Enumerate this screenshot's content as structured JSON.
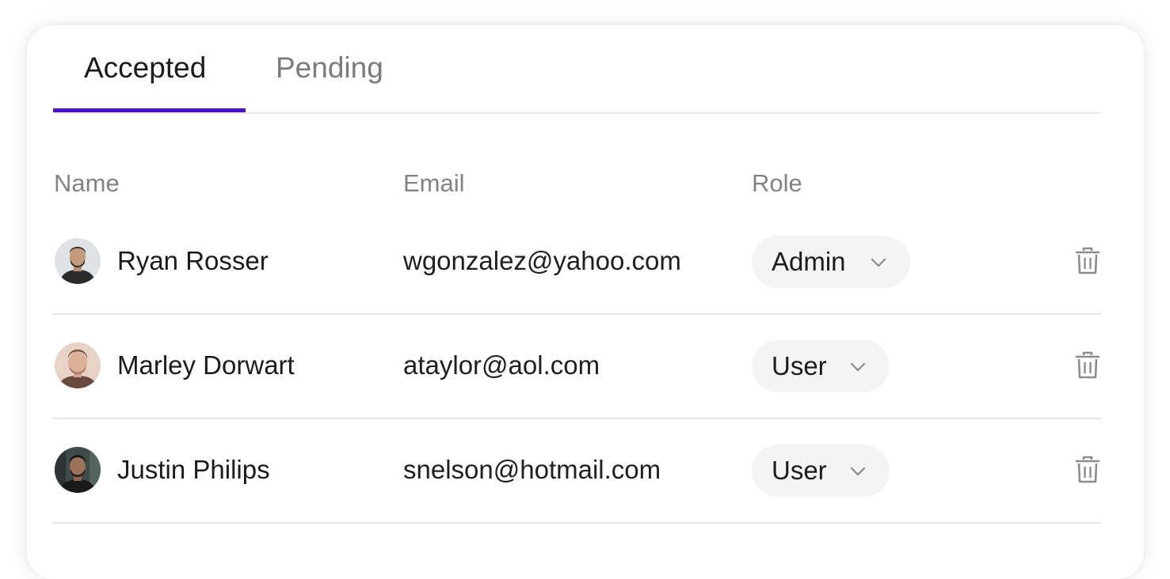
{
  "tabs": [
    {
      "label": "Accepted",
      "active": true
    },
    {
      "label": "Pending",
      "active": false
    }
  ],
  "accent_color": "#4b12c6",
  "table": {
    "columns": [
      "Name",
      "Email",
      "Role"
    ],
    "rows": [
      {
        "name": "Ryan Rosser",
        "email": "wgonzalez@yahoo.com",
        "role": "Admin",
        "avatar_icon": "avatar-photo",
        "action_icon": "trash-icon"
      },
      {
        "name": "Marley Dorwart",
        "email": "ataylor@aol.com",
        "role": "User",
        "avatar_icon": "avatar-photo",
        "action_icon": "trash-icon"
      },
      {
        "name": "Justin Philips",
        "email": "snelson@hotmail.com",
        "role": "User",
        "avatar_icon": "avatar-photo",
        "action_icon": "trash-icon"
      }
    ]
  }
}
